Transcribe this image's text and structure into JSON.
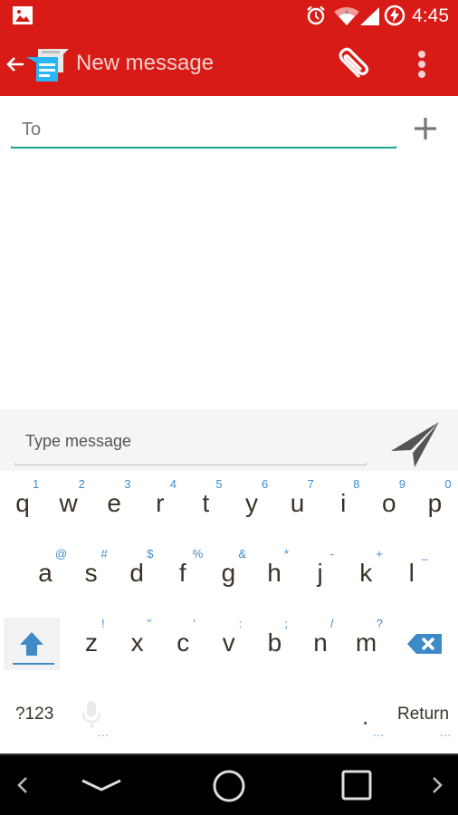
{
  "status_bar": {
    "time": "4:45",
    "icons": [
      "image-notification-icon",
      "alarm-icon",
      "wifi-icon",
      "cell-signal-icon",
      "battery-charging-icon"
    ]
  },
  "app_bar": {
    "title": "New message",
    "back_icon": "arrow-left-icon",
    "app_icon": "messenger-icon",
    "actions": [
      "paperclip-icon",
      "more-vert-icon"
    ],
    "color": "#d81b16"
  },
  "recipient": {
    "value": "",
    "placeholder": "To",
    "accent": "#1aa593",
    "add_icon": "plus-icon"
  },
  "compose": {
    "value": "",
    "placeholder": "Type message",
    "send_icon": "send-icon"
  },
  "keyboard": {
    "row1": [
      {
        "key": "q",
        "hint": "1"
      },
      {
        "key": "w",
        "hint": "2"
      },
      {
        "key": "e",
        "hint": "3"
      },
      {
        "key": "r",
        "hint": "4"
      },
      {
        "key": "t",
        "hint": "5"
      },
      {
        "key": "y",
        "hint": "6"
      },
      {
        "key": "u",
        "hint": "7"
      },
      {
        "key": "i",
        "hint": "8"
      },
      {
        "key": "o",
        "hint": "9"
      },
      {
        "key": "p",
        "hint": "0"
      }
    ],
    "row2": [
      {
        "key": "a",
        "hint": "@"
      },
      {
        "key": "s",
        "hint": "#"
      },
      {
        "key": "d",
        "hint": "$"
      },
      {
        "key": "f",
        "hint": "%"
      },
      {
        "key": "g",
        "hint": "&"
      },
      {
        "key": "h",
        "hint": "*"
      },
      {
        "key": "j",
        "hint": "-"
      },
      {
        "key": "k",
        "hint": "+"
      },
      {
        "key": "l",
        "hint": "_"
      }
    ],
    "row3": [
      {
        "key": "z",
        "hint": "!"
      },
      {
        "key": "x",
        "hint": "\""
      },
      {
        "key": "c",
        "hint": "'"
      },
      {
        "key": "v",
        "hint": ":"
      },
      {
        "key": "b",
        "hint": ";"
      },
      {
        "key": "n",
        "hint": "/"
      },
      {
        "key": "m",
        "hint": "?"
      }
    ],
    "symbols_label": "?123",
    "period_label": ".",
    "return_label": "Return",
    "more_dots": "...",
    "accent": "#3e8ac6"
  },
  "nav_bar": {
    "buttons": [
      "chevron-left-icon",
      "hide-keyboard-icon",
      "home-icon",
      "recents-icon",
      "chevron-right-icon"
    ]
  }
}
